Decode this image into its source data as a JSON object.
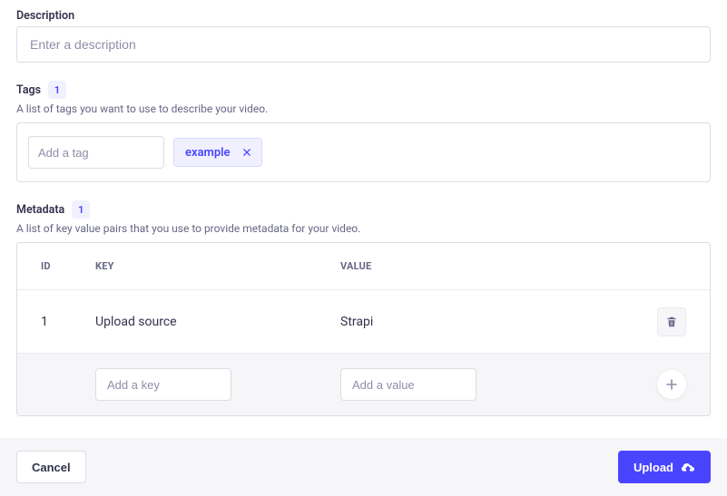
{
  "description": {
    "label": "Description",
    "placeholder": "Enter a description",
    "value": ""
  },
  "tags": {
    "label": "Tags",
    "count": "1",
    "help": "A list of tags you want to use to describe your video.",
    "input_placeholder": "Add a tag",
    "items": [
      "example"
    ]
  },
  "metadata": {
    "label": "Metadata",
    "count": "1",
    "help": "A list of key value pairs that you use to provide metadata for your video.",
    "headers": {
      "id": "ID",
      "key": "KEY",
      "value": "VALUE"
    },
    "rows": [
      {
        "id": "1",
        "key": "Upload source",
        "value": "Strapi"
      }
    ],
    "add": {
      "key_placeholder": "Add a key",
      "value_placeholder": "Add a value"
    }
  },
  "footer": {
    "cancel": "Cancel",
    "upload": "Upload"
  }
}
